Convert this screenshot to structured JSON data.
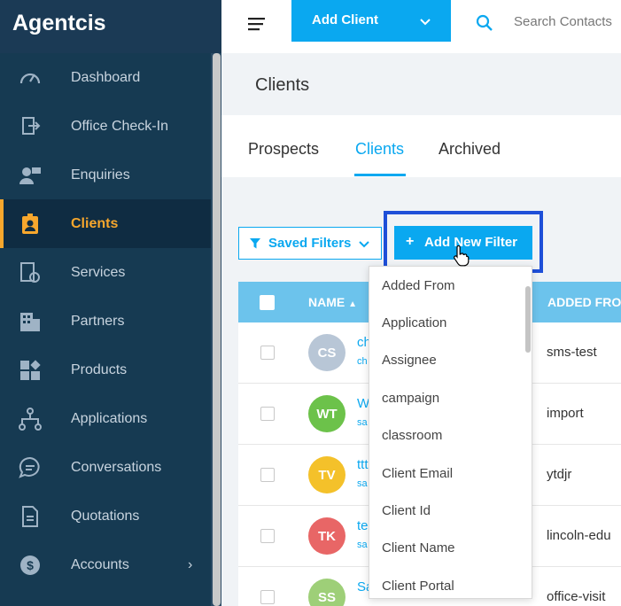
{
  "brand": {
    "name": "Agentcis"
  },
  "sidebar": {
    "items": [
      {
        "label": "Dashboard",
        "icon": "gauge-icon"
      },
      {
        "label": "Office Check-In",
        "icon": "check-in-icon"
      },
      {
        "label": "Enquiries",
        "icon": "enquiries-icon"
      },
      {
        "label": "Clients",
        "icon": "id-badge-icon",
        "active": true
      },
      {
        "label": "Services",
        "icon": "services-icon"
      },
      {
        "label": "Partners",
        "icon": "building-icon"
      },
      {
        "label": "Products",
        "icon": "products-icon"
      },
      {
        "label": "Applications",
        "icon": "flow-icon"
      },
      {
        "label": "Conversations",
        "icon": "chat-icon"
      },
      {
        "label": "Quotations",
        "icon": "document-icon"
      },
      {
        "label": "Accounts",
        "icon": "dollar-icon"
      }
    ]
  },
  "topbar": {
    "add_client_label": "Add Client",
    "search_placeholder": "Search Contacts"
  },
  "page": {
    "title": "Clients"
  },
  "tabs": [
    {
      "label": "Prospects"
    },
    {
      "label": "Clients",
      "active": true
    },
    {
      "label": "Archived"
    }
  ],
  "filters": {
    "saved_label": "Saved Filters",
    "add_label": "Add New Filter",
    "plus": "+"
  },
  "table": {
    "columns": {
      "name": "NAME",
      "added_from": "ADDED FROM"
    },
    "rows": [
      {
        "initials": "CS",
        "color": "#b8c6d6",
        "name": "ch",
        "email": "ch",
        "source": "sms-test"
      },
      {
        "initials": "WT",
        "color": "#6cc24a",
        "name": "W",
        "email": "sa",
        "source": "import"
      },
      {
        "initials": "TV",
        "color": "#f4c12a",
        "name": "ttt",
        "email": "sa",
        "source": "ytdjr"
      },
      {
        "initials": "TK",
        "color": "#e86666",
        "name": "te",
        "email": "sa",
        "source": "lincoln-edu"
      },
      {
        "initials": "SS",
        "color": "#9ecf78",
        "name": "Sa",
        "email": "",
        "source": "office-visit"
      }
    ]
  },
  "dropdown": {
    "items": [
      "Added From",
      "Application",
      "Assignee",
      "campaign",
      "classroom",
      "Client Email",
      "Client Id",
      "Client Name",
      "Client Portal"
    ]
  },
  "colors": {
    "accent": "#0aa8f0",
    "sidebar_bg": "#163a52",
    "active_orange": "#f7a72d",
    "highlight": "#1e4fd8"
  }
}
